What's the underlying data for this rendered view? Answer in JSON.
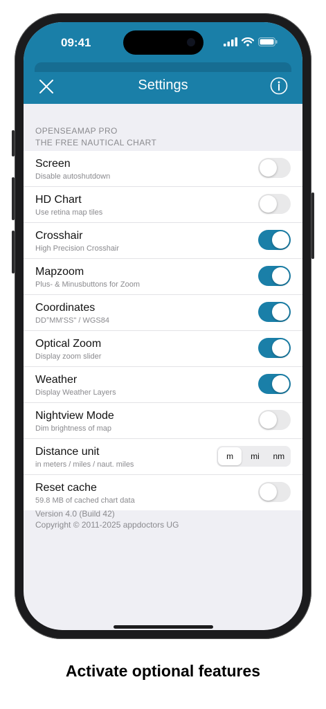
{
  "status_bar": {
    "time": "09:41"
  },
  "nav": {
    "title": "Settings"
  },
  "group_header": {
    "line1": "OPENSEAMAP PRO",
    "line2": "THE FREE NAUTICAL CHART"
  },
  "rows": [
    {
      "title": "Screen",
      "subtitle": "Disable autoshutdown",
      "on": false
    },
    {
      "title": "HD Chart",
      "subtitle": "Use retina map tiles",
      "on": false
    },
    {
      "title": "Crosshair",
      "subtitle": "High Precision Crosshair",
      "on": true
    },
    {
      "title": "Mapzoom",
      "subtitle": "Plus- & Minusbuttons for Zoom",
      "on": true
    },
    {
      "title": "Coordinates",
      "subtitle": "DD°MM'SS\" / WGS84",
      "on": true
    },
    {
      "title": "Optical Zoom",
      "subtitle": "Display zoom slider",
      "on": true
    },
    {
      "title": "Weather",
      "subtitle": "Display Weather Layers",
      "on": true
    },
    {
      "title": "Nightview Mode",
      "subtitle": "Dim brightness of map",
      "on": false
    },
    {
      "title": "Distance unit",
      "subtitle": "in meters / miles / naut. miles",
      "segments": [
        "m",
        "mi",
        "nm"
      ],
      "selected": "m"
    },
    {
      "title": "Reset cache",
      "subtitle": "59.8 MB of cached chart data",
      "on": false
    }
  ],
  "footer": {
    "version": "Version 4.0 (Build 42)",
    "copyright": "Copyright © 2011-2025 appdoctors UG"
  },
  "caption": "Activate optional features",
  "colors": {
    "accent": "#1a7fa8",
    "toggle_off": "#e9e9ea",
    "background": "#efeff4"
  },
  "icons": {
    "close": "close-icon",
    "info": "info-icon",
    "signal": "signal-icon",
    "wifi": "wifi-icon",
    "battery": "battery-icon"
  }
}
